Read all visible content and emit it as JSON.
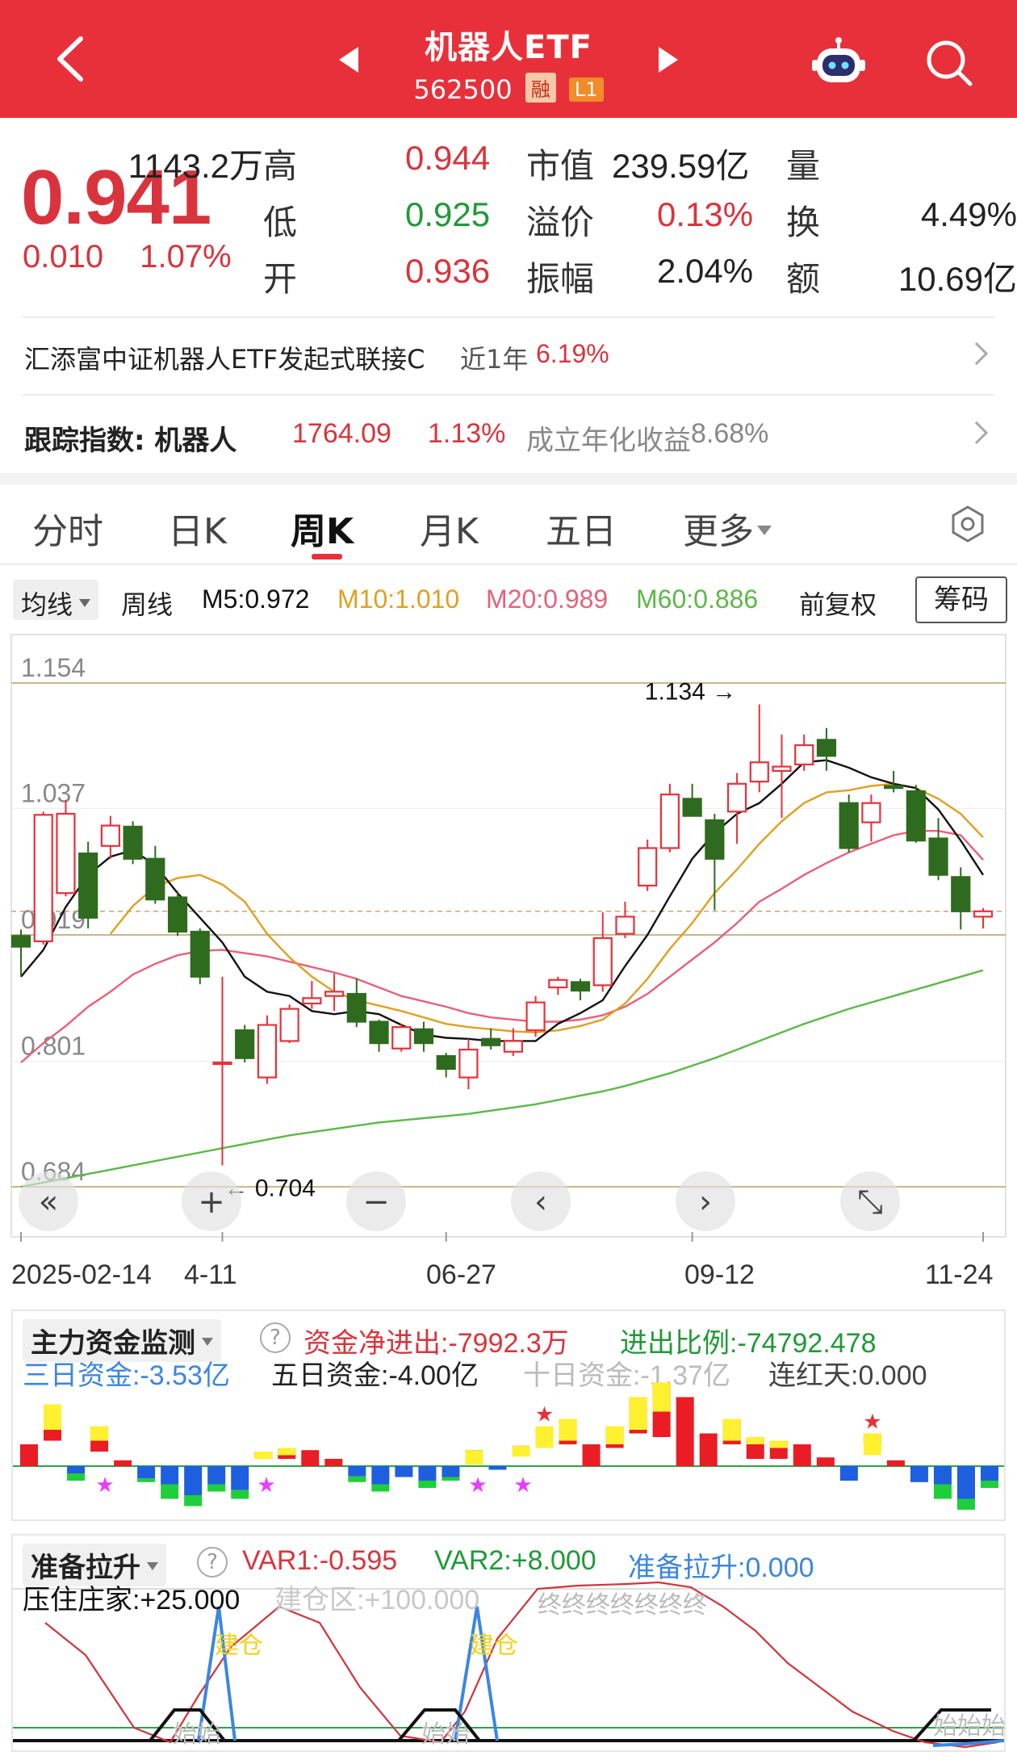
{
  "header": {
    "title": "机器人ETF",
    "code": "562500",
    "badge_margin": "融",
    "badge_level": "L1",
    "accent": "#e8303a"
  },
  "quote": {
    "price": "0.941",
    "change": "0.010",
    "change_pct": "1.07%",
    "rows": [
      {
        "l1": "高",
        "v1": "0.944",
        "l2": "市值",
        "v2": "239.59亿",
        "l3": "量",
        "v3": "1143.2万"
      },
      {
        "l1": "低",
        "v1": "0.925",
        "l2": "溢价",
        "v2": "0.13%",
        "l3": "换",
        "v3": "4.49%"
      },
      {
        "l1": "开",
        "v1": "0.936",
        "l2": "振幅",
        "v2": "2.04%",
        "l3": "额",
        "v3": "10.69亿"
      }
    ]
  },
  "fund": {
    "name": "汇添富中证机器人ETF发起式联接C",
    "period": "近1年",
    "return": "6.19%"
  },
  "index": {
    "label": "跟踪指数: 机器人",
    "value": "1764.09",
    "pct": "1.13%",
    "annual_label": "成立年化收益",
    "annual_value": "8.68%"
  },
  "tabs": [
    "分时",
    "日K",
    "周K",
    "月K",
    "五日",
    "更多"
  ],
  "active_tab": "周K",
  "ma_bar": {
    "selector": "均线",
    "period": "周线",
    "m5": "M5:0.972",
    "m10": "M10:1.010",
    "m20": "M20:0.989",
    "m60": "M60:0.886",
    "adjust": "前复权",
    "chip_button": "筹码",
    "colors": {
      "m5": "#111111",
      "m10": "#e0a020",
      "m20": "#e8607a",
      "m60": "#5cb848"
    }
  },
  "kline": {
    "y_ticks": [
      "1.154",
      "1.037",
      "0.919",
      "0.801",
      "0.684"
    ],
    "high_mark": "1.134",
    "low_mark": "0.704",
    "dates": [
      "2025-02-14",
      "4-11",
      "06-27",
      "09-12",
      "11-24"
    ],
    "candles": [
      [
        0.918,
        0.908,
        0.924,
        0.88
      ],
      [
        0.913,
        1.031,
        1.034,
        0.91
      ],
      [
        0.958,
        1.032,
        1.045,
        0.955
      ],
      [
        0.995,
        0.935,
        1.006,
        0.925
      ],
      [
        1.002,
        1.021,
        1.03,
        0.99
      ],
      [
        1.02,
        0.99,
        1.025,
        0.985
      ],
      [
        0.99,
        0.952,
        1.002,
        0.948
      ],
      [
        0.954,
        0.922,
        0.96,
        0.918
      ],
      [
        0.922,
        0.88,
        0.925,
        0.873
      ],
      [
        0.8,
        0.8,
        0.88,
        0.704
      ],
      [
        0.83,
        0.804,
        0.835,
        0.8
      ],
      [
        0.786,
        0.835,
        0.844,
        0.78
      ],
      [
        0.82,
        0.85,
        0.854,
        0.818
      ],
      [
        0.855,
        0.86,
        0.876,
        0.85
      ],
      [
        0.862,
        0.866,
        0.883,
        0.848
      ],
      [
        0.864,
        0.838,
        0.878,
        0.833
      ],
      [
        0.838,
        0.818,
        0.84,
        0.81
      ],
      [
        0.813,
        0.833,
        0.836,
        0.81
      ],
      [
        0.831,
        0.818,
        0.838,
        0.81
      ],
      [
        0.806,
        0.794,
        0.809,
        0.786
      ],
      [
        0.786,
        0.812,
        0.822,
        0.775
      ],
      [
        0.822,
        0.816,
        0.832,
        0.812
      ],
      [
        0.81,
        0.82,
        0.832,
        0.806
      ],
      [
        0.83,
        0.856,
        0.862,
        0.824
      ],
      [
        0.87,
        0.877,
        0.88,
        0.863
      ],
      [
        0.875,
        0.867,
        0.878,
        0.858
      ],
      [
        0.872,
        0.916,
        0.94,
        0.866
      ],
      [
        0.92,
        0.936,
        0.95,
        0.916
      ],
      [
        0.965,
        1.0,
        1.008,
        0.96
      ],
      [
        1.0,
        1.05,
        1.06,
        0.996
      ],
      [
        1.046,
        1.03,
        1.06,
        1.03
      ],
      [
        1.026,
        0.99,
        1.032,
        0.942
      ],
      [
        1.034,
        1.06,
        1.07,
        1.004
      ],
      [
        1.062,
        1.08,
        1.134,
        1.052
      ],
      [
        1.072,
        1.076,
        1.106,
        1.028
      ],
      [
        1.078,
        1.096,
        1.106,
        1.072
      ],
      [
        1.101,
        1.086,
        1.112,
        1.072
      ],
      [
        1.042,
        1.0,
        1.05,
        0.996
      ],
      [
        1.024,
        1.042,
        1.05,
        1.006
      ],
      [
        1.058,
        1.056,
        1.072,
        1.052
      ],
      [
        1.053,
        1.007,
        1.059,
        1.005
      ],
      [
        1.009,
        0.975,
        1.028,
        0.97
      ],
      [
        0.973,
        0.941,
        0.982,
        0.924
      ],
      [
        0.936,
        0.941,
        0.944,
        0.925
      ]
    ],
    "ma5": [
      0.88,
      0.905,
      0.945,
      0.975,
      0.992,
      0.998,
      0.984,
      0.958,
      0.935,
      0.912,
      0.88,
      0.866,
      0.862,
      0.848,
      0.845,
      0.848,
      0.845,
      0.835,
      0.826,
      0.823,
      0.822,
      0.82,
      0.82,
      0.82,
      0.836,
      0.846,
      0.858,
      0.89,
      0.919,
      0.955,
      0.99,
      1.014,
      1.032,
      1.042,
      1.06,
      1.08,
      1.082,
      1.075,
      1.066,
      1.06,
      1.056,
      1.036,
      1.007,
      0.975
    ],
    "ma10": [
      null,
      null,
      null,
      null,
      0.92,
      0.946,
      0.964,
      0.972,
      0.975,
      0.966,
      0.95,
      0.92,
      0.898,
      0.88,
      0.866,
      0.858,
      0.853,
      0.848,
      0.842,
      0.836,
      0.833,
      0.831,
      0.829,
      0.828,
      0.83,
      0.834,
      0.84,
      0.855,
      0.878,
      0.906,
      0.93,
      0.958,
      0.98,
      1.004,
      1.025,
      1.042,
      1.052,
      1.054,
      1.058,
      1.06,
      1.056,
      1.046,
      1.032,
      1.01
    ],
    "ma20": [
      0.8,
      0.818,
      0.834,
      0.852,
      0.866,
      0.882,
      0.892,
      0.9,
      0.904,
      0.905,
      0.902,
      0.899,
      0.894,
      0.889,
      0.884,
      0.878,
      0.87,
      0.862,
      0.857,
      0.852,
      0.846,
      0.842,
      0.84,
      0.838,
      0.838,
      0.84,
      0.844,
      0.852,
      0.864,
      0.88,
      0.896,
      0.912,
      0.93,
      0.95,
      0.962,
      0.975,
      0.986,
      0.996,
      1.004,
      1.012,
      1.016,
      1.016,
      1.012,
      0.989
    ],
    "ma60": [
      0.684,
      0.688,
      0.692,
      0.696,
      0.7,
      0.704,
      0.708,
      0.712,
      0.716,
      0.72,
      0.724,
      0.728,
      0.732,
      0.735,
      0.738,
      0.741,
      0.744,
      0.746,
      0.748,
      0.75,
      0.752,
      0.755,
      0.758,
      0.761,
      0.765,
      0.769,
      0.773,
      0.778,
      0.784,
      0.79,
      0.797,
      0.804,
      0.812,
      0.82,
      0.828,
      0.836,
      0.843,
      0.85,
      0.856,
      0.862,
      0.868,
      0.874,
      0.88,
      0.886
    ]
  },
  "fund_flow": {
    "selector": "主力资金监测",
    "net_label": "资金净进出:",
    "net_value": "-7992.3万",
    "ratio_label": "进出比例:",
    "ratio_value": "-74792.478",
    "d3_label": "三日资金:",
    "d3_value": "-3.53亿",
    "d5_label": "五日资金:",
    "d5_value": "-4.00亿",
    "d10_label": "十日资金:",
    "d10_value": "-1.37亿",
    "red_days": "连红天:0.000",
    "bars": [
      [
        0.3,
        0.0,
        0
      ],
      [
        0.85,
        0.35,
        0
      ],
      [
        -0.2,
        -0.1,
        0
      ],
      [
        0.55,
        0.2,
        0
      ],
      [
        0.08,
        0.0,
        0
      ],
      [
        -0.22,
        -0.05,
        0
      ],
      [
        -0.45,
        -0.2,
        0
      ],
      [
        -0.55,
        -0.15,
        0
      ],
      [
        -0.35,
        -0.1,
        0
      ],
      [
        -0.45,
        -0.12,
        0
      ],
      [
        0.2,
        0.1,
        0
      ],
      [
        0.25,
        0.1,
        0
      ],
      [
        0.22,
        0.0,
        0
      ],
      [
        0.1,
        0.0,
        0
      ],
      [
        -0.22,
        -0.08,
        0
      ],
      [
        -0.35,
        -0.1,
        0
      ],
      [
        -0.15,
        0.0,
        0
      ],
      [
        -0.3,
        -0.1,
        0
      ],
      [
        -0.2,
        -0.05,
        0
      ],
      [
        0.22,
        0.2,
        0
      ],
      [
        -0.05,
        0.0,
        0
      ],
      [
        0.28,
        0.15,
        0
      ],
      [
        0.55,
        0.3,
        1
      ],
      [
        0.65,
        0.3,
        0
      ],
      [
        0.3,
        0.0,
        0
      ],
      [
        0.55,
        0.25,
        0
      ],
      [
        0.95,
        0.45,
        0
      ],
      [
        1.15,
        0.4,
        0
      ],
      [
        0.95,
        0.0,
        0
      ],
      [
        0.45,
        0.0,
        0
      ],
      [
        0.65,
        0.3,
        0
      ],
      [
        0.4,
        0.1,
        0
      ],
      [
        0.35,
        0.1,
        0
      ],
      [
        0.3,
        0.0,
        0
      ],
      [
        0.12,
        0.0,
        0
      ],
      [
        -0.2,
        0.0,
        0
      ],
      [
        0.45,
        0.3,
        1
      ],
      [
        0.08,
        0.0,
        0
      ],
      [
        -0.22,
        -0.0,
        0
      ],
      [
        -0.45,
        -0.2,
        0
      ],
      [
        -0.6,
        -0.15,
        0
      ],
      [
        -0.3,
        -0.1,
        0
      ]
    ],
    "purple_star_positions": [
      4,
      11,
      20,
      22
    ]
  },
  "pull": {
    "selector": "准备拉升",
    "var1_label": "VAR1:",
    "var1_value": "-0.595",
    "var2_label": "VAR2:",
    "var2_value": "+8.000",
    "ready_label": "准备拉升:",
    "ready_value": "0.000",
    "press_label": "压住庄家:",
    "press_value": "+25.000",
    "build_label": "建仓区:",
    "build_value": "+100.000",
    "end_text": "终终终终终终终",
    "build_text_1": "建仓",
    "build_text_2": "建仓",
    "start_text_1": "始始",
    "start_text_2": "始始",
    "start_text_3": "始始始"
  },
  "chart_controls": [
    "«",
    "+",
    "−",
    "‹",
    "›",
    "⤡"
  ]
}
